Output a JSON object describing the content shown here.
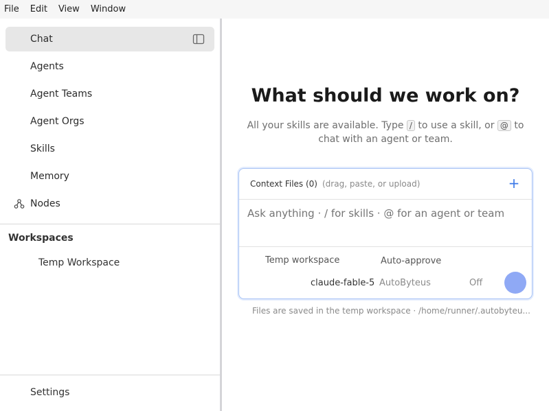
{
  "menubar": {
    "items": [
      "File",
      "Edit",
      "View",
      "Window"
    ]
  },
  "sidebar": {
    "items": [
      {
        "label": "Chat",
        "active": true
      },
      {
        "label": "Agents"
      },
      {
        "label": "Agent Teams"
      },
      {
        "label": "Agent Orgs"
      },
      {
        "label": "Skills"
      },
      {
        "label": "Memory"
      },
      {
        "label": "Nodes",
        "icon": "nodes-icon"
      }
    ],
    "workspaces_title": "Workspaces",
    "workspaces": [
      "Temp Workspace"
    ],
    "settings_label": "Settings",
    "collapse_icon": "sidebar-toggle-icon"
  },
  "main": {
    "headline": "What should we work on?",
    "sub_part1": "All your skills are available. Type",
    "kbd_slash": "/",
    "sub_part2": "to use a skill, or",
    "kbd_at": "@",
    "sub_part3": "to chat with an agent or team.",
    "composer": {
      "context_label": "Context Files (0)",
      "context_hint": "(drag, paste, or upload)",
      "placeholder": "Ask anything · / for skills · @ for an agent or team",
      "workspace": "Temp workspace",
      "auto_approve_label": "Auto-approve",
      "model": "claude-fable-5",
      "provider": "AutoByteus",
      "auto_approve_state": "Off"
    },
    "footnote": "Files are saved in the temp workspace · /home/runner/.autobyteu..."
  },
  "colors": {
    "accent": "#3b78e7",
    "send_button": "#8fa9f5",
    "active_bg": "#e7e7e7"
  }
}
